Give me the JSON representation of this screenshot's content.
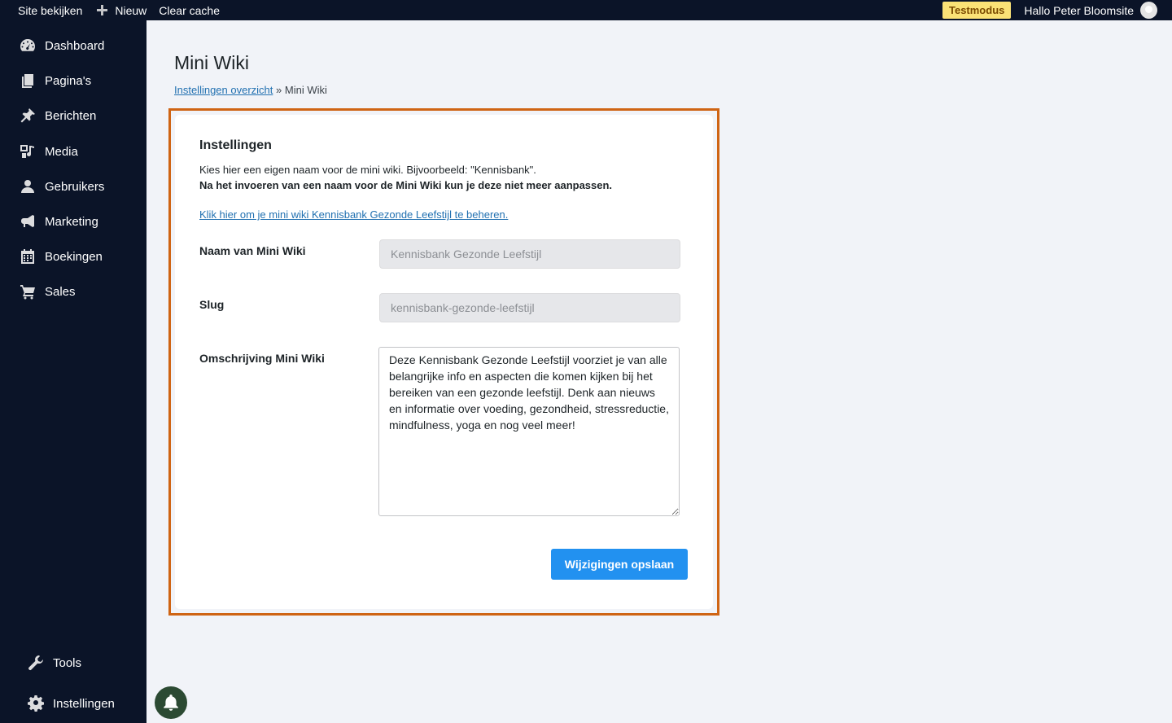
{
  "topbar": {
    "site_label": "Site bekijken",
    "new_label": "Nieuw",
    "cache_label": "Clear cache",
    "test_badge": "Testmodus",
    "greeting": "Hallo Peter Bloomsite"
  },
  "sidebar": {
    "items": [
      {
        "label": "Dashboard",
        "icon": "dashboard-icon"
      },
      {
        "label": "Pagina's",
        "icon": "pages-icon"
      },
      {
        "label": "Berichten",
        "icon": "pin-icon"
      },
      {
        "label": "Media",
        "icon": "media-icon"
      },
      {
        "label": "Gebruikers",
        "icon": "user-icon"
      },
      {
        "label": "Marketing",
        "icon": "megaphone-icon"
      },
      {
        "label": "Boekingen",
        "icon": "calendar-icon"
      },
      {
        "label": "Sales",
        "icon": "cart-icon"
      }
    ],
    "bottom_items": [
      {
        "label": "Tools",
        "icon": "wrench-icon"
      },
      {
        "label": "Instellingen",
        "icon": "gear-icon"
      }
    ]
  },
  "main": {
    "title": "Mini Wiki",
    "breadcrumb": {
      "link": "Instellingen overzicht",
      "separator": "»",
      "current": "Mini Wiki"
    },
    "card": {
      "title": "Instellingen",
      "description": "Kies hier een eigen naam voor de mini wiki. Bijvoorbeeld: \"Kennisbank\".",
      "warning": "Na het invoeren van een naam voor de Mini Wiki kun je deze niet meer aanpassen.",
      "manage_link": "Klik hier om je mini wiki Kennisbank Gezonde Leefstijl te beheren.",
      "fields": {
        "name": {
          "label": "Naam van Mini Wiki",
          "value": "Kennisbank Gezonde Leefstijl"
        },
        "slug": {
          "label": "Slug",
          "value": "kennisbank-gezonde-leefstijl"
        },
        "description": {
          "label": "Omschrijving Mini Wiki",
          "value": "Deze Kennisbank Gezonde Leefstijl voorziet je van alle belangrijke info en aspecten die komen kijken bij het bereiken van een gezonde leefstijl. Denk aan nieuws en informatie over voeding, gezondheid, stressreductie, mindfulness, yoga en nog veel meer!"
        }
      },
      "save_label": "Wijzigingen opslaan"
    }
  },
  "colors": {
    "sidebar_bg": "#0b1428",
    "highlight_border": "#cf6414",
    "primary_button": "#2291f0",
    "link": "#2271b1",
    "test_badge_bg": "#fbe276"
  }
}
